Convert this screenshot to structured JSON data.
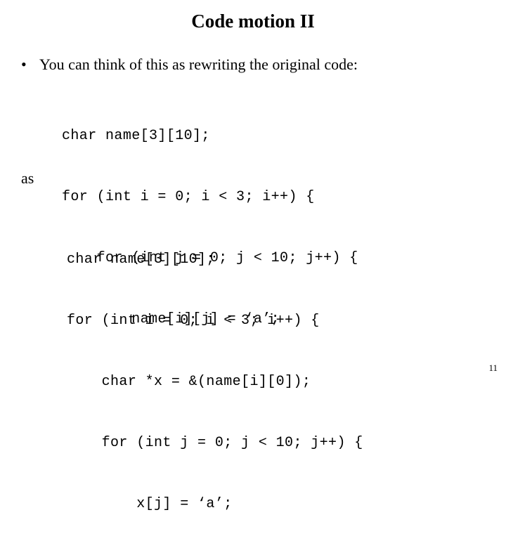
{
  "slide": {
    "title": "Code motion II",
    "page_number": "11",
    "background_color": "#ffffff",
    "text_color": "#000000"
  },
  "bullet": {
    "marker": "•",
    "text": "You can think of this as rewriting the original code:"
  },
  "connector": {
    "label": "as"
  },
  "code_original": {
    "lines": [
      "char name[3][10];",
      "for (int i = 0; i < 3; i++) {",
      "    for (int j = 0; j < 10; j++) {",
      "        name[i][j] = ‘a’;"
    ]
  },
  "code_rewritten": {
    "lines": [
      "char name[3][10];",
      "for (int i = 0; i < 3; i++) {",
      "    char *x = &(name[i][0]);",
      "    for (int j = 0; j < 10; j++) {",
      "        x[j] = ‘a’;"
    ]
  }
}
